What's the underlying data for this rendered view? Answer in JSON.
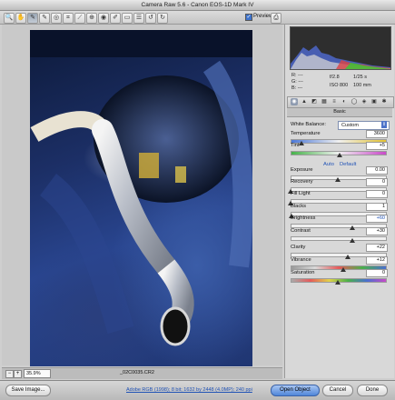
{
  "window": {
    "title": "Camera Raw 5.6  -  Canon EOS-1D Mark IV"
  },
  "toolbar": {
    "tools": [
      {
        "name": "zoom-tool",
        "glyph": "🔍"
      },
      {
        "name": "hand-tool",
        "glyph": "✋"
      },
      {
        "name": "white-balance-tool",
        "glyph": "✎"
      },
      {
        "name": "color-sampler-tool",
        "glyph": "✎"
      },
      {
        "name": "targeted-adjustment-tool",
        "glyph": "◎"
      },
      {
        "name": "crop-tool",
        "glyph": "⌗"
      },
      {
        "name": "straighten-tool",
        "glyph": "⟋"
      },
      {
        "name": "spot-removal-tool",
        "glyph": "⊕"
      },
      {
        "name": "red-eye-tool",
        "glyph": "◉"
      },
      {
        "name": "adjustment-brush-tool",
        "glyph": "✐"
      },
      {
        "name": "graduated-filter-tool",
        "glyph": "▭"
      },
      {
        "name": "preferences-tool",
        "glyph": "☰"
      },
      {
        "name": "rotate-left-tool",
        "glyph": "↺"
      },
      {
        "name": "rotate-right-tool",
        "glyph": "↻"
      }
    ],
    "preview_label": "Preview",
    "preview_checked": true
  },
  "image": {
    "zoom_value": "35.9%",
    "filename": "_02C0035.CR2"
  },
  "readout": {
    "r": "R:  ---",
    "g": "G:  ---",
    "b": "B:  ---",
    "aperture": "f/2.8",
    "shutter": "1/25 s",
    "iso": "ISO 800",
    "focal": "100 mm"
  },
  "panel": {
    "tabs": [
      "◉",
      "▲",
      "◩",
      "▦",
      "≡",
      "◐",
      "◯",
      "◈",
      "▣",
      "✱"
    ],
    "section_title": "Basic",
    "white_balance_label": "White Balance:",
    "white_balance_value": "Custom",
    "auto_label": "Auto",
    "default_label": "Default",
    "sliders": [
      {
        "label": "Temperature",
        "value": "3600",
        "pos": 0.12,
        "color": "temp"
      },
      {
        "label": "Tint",
        "value": "+5",
        "pos": 0.52,
        "color": "tint"
      },
      {
        "label": "Exposure",
        "value": "0.00",
        "pos": 0.5,
        "color": "plain"
      },
      {
        "label": "Recovery",
        "value": "0",
        "pos": 0.0,
        "color": "plain"
      },
      {
        "label": "Fill Light",
        "value": "0",
        "pos": 0.0,
        "color": "plain"
      },
      {
        "label": "Blacks",
        "value": "1",
        "pos": 0.01,
        "color": "plain"
      },
      {
        "label": "Brightness",
        "value": "+60",
        "pos": 0.65,
        "color": "plain"
      },
      {
        "label": "Contrast",
        "value": "+30",
        "pos": 0.65,
        "color": "plain"
      },
      {
        "label": "Clarity",
        "value": "+22",
        "pos": 0.61,
        "color": "plain"
      },
      {
        "label": "Vibrance",
        "value": "+12",
        "pos": 0.56,
        "color": "vib"
      },
      {
        "label": "Saturation",
        "value": "0",
        "pos": 0.5,
        "color": "sat"
      }
    ]
  },
  "footer": {
    "save_label": "Save Image...",
    "workflow_text": "Adobe RGB (1998); 8 bit; 1632 by 2448 (4.0MP); 240 ppi",
    "open_label": "Open Object",
    "cancel_label": "Cancel",
    "done_label": "Done"
  },
  "colors": {
    "accent": "#4f86d9",
    "link": "#2153b6",
    "histogram_bg": "#2e2e2e"
  }
}
